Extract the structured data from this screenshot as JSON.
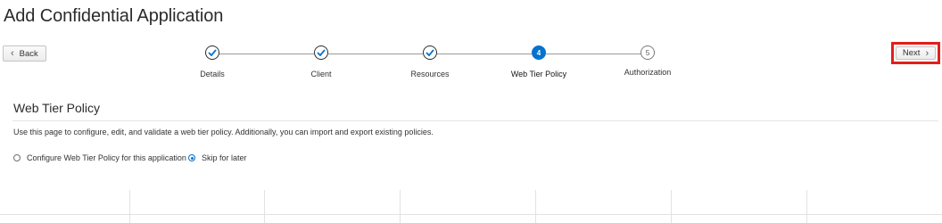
{
  "page": {
    "title": "Add Confidential Application"
  },
  "nav": {
    "back_label": "Back",
    "next_label": "Next"
  },
  "train": {
    "steps": [
      {
        "label": "Details",
        "state": "done"
      },
      {
        "label": "Client",
        "state": "done"
      },
      {
        "label": "Resources",
        "state": "done"
      },
      {
        "label": "Web Tier Policy",
        "state": "current",
        "number": "4"
      },
      {
        "label": "Authorization",
        "state": "todo",
        "number": "5"
      }
    ]
  },
  "section": {
    "title": "Web Tier Policy",
    "description": "Use this page to configure, edit, and validate a web tier policy. Additionally, you can import and export existing policies."
  },
  "options": [
    {
      "label": "Configure Web Tier Policy for this application",
      "selected": false
    },
    {
      "label": "Skip for later",
      "selected": true
    }
  ],
  "colors": {
    "accent": "#0572ce",
    "highlight": "#e0201a"
  }
}
